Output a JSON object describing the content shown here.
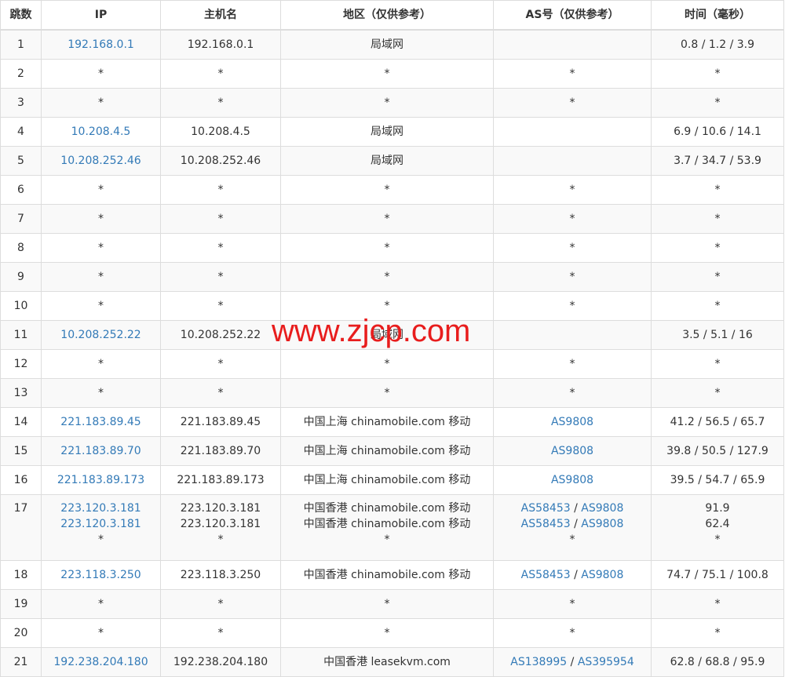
{
  "headers": [
    "跳数",
    "IP",
    "主机名",
    "地区（仅供参考）",
    "AS号（仅供参考）",
    "时间（毫秒）"
  ],
  "rows": [
    {
      "hop": "1",
      "ip": [
        "192.168.0.1"
      ],
      "host": [
        "192.168.0.1"
      ],
      "region": [
        "局域网"
      ],
      "as": [
        []
      ],
      "time": [
        "0.8 / 1.2 / 3.9"
      ]
    },
    {
      "hop": "2",
      "ip": [
        "*"
      ],
      "host": [
        "*"
      ],
      "region": [
        "*"
      ],
      "as": [
        [
          "*"
        ]
      ],
      "time": [
        "*"
      ]
    },
    {
      "hop": "3",
      "ip": [
        "*"
      ],
      "host": [
        "*"
      ],
      "region": [
        "*"
      ],
      "as": [
        [
          "*"
        ]
      ],
      "time": [
        "*"
      ]
    },
    {
      "hop": "4",
      "ip": [
        "10.208.4.5"
      ],
      "host": [
        "10.208.4.5"
      ],
      "region": [
        "局域网"
      ],
      "as": [
        []
      ],
      "time": [
        "6.9 / 10.6 / 14.1"
      ]
    },
    {
      "hop": "5",
      "ip": [
        "10.208.252.46"
      ],
      "host": [
        "10.208.252.46"
      ],
      "region": [
        "局域网"
      ],
      "as": [
        []
      ],
      "time": [
        "3.7 / 34.7 / 53.9"
      ]
    },
    {
      "hop": "6",
      "ip": [
        "*"
      ],
      "host": [
        "*"
      ],
      "region": [
        "*"
      ],
      "as": [
        [
          "*"
        ]
      ],
      "time": [
        "*"
      ]
    },
    {
      "hop": "7",
      "ip": [
        "*"
      ],
      "host": [
        "*"
      ],
      "region": [
        "*"
      ],
      "as": [
        [
          "*"
        ]
      ],
      "time": [
        "*"
      ]
    },
    {
      "hop": "8",
      "ip": [
        "*"
      ],
      "host": [
        "*"
      ],
      "region": [
        "*"
      ],
      "as": [
        [
          "*"
        ]
      ],
      "time": [
        "*"
      ]
    },
    {
      "hop": "9",
      "ip": [
        "*"
      ],
      "host": [
        "*"
      ],
      "region": [
        "*"
      ],
      "as": [
        [
          "*"
        ]
      ],
      "time": [
        "*"
      ]
    },
    {
      "hop": "10",
      "ip": [
        "*"
      ],
      "host": [
        "*"
      ],
      "region": [
        "*"
      ],
      "as": [
        [
          "*"
        ]
      ],
      "time": [
        "*"
      ]
    },
    {
      "hop": "11",
      "ip": [
        "10.208.252.22"
      ],
      "host": [
        "10.208.252.22"
      ],
      "region": [
        "局域网"
      ],
      "as": [
        []
      ],
      "time": [
        "3.5 / 5.1 / 16"
      ]
    },
    {
      "hop": "12",
      "ip": [
        "*"
      ],
      "host": [
        "*"
      ],
      "region": [
        "*"
      ],
      "as": [
        [
          "*"
        ]
      ],
      "time": [
        "*"
      ]
    },
    {
      "hop": "13",
      "ip": [
        "*"
      ],
      "host": [
        "*"
      ],
      "region": [
        "*"
      ],
      "as": [
        [
          "*"
        ]
      ],
      "time": [
        "*"
      ]
    },
    {
      "hop": "14",
      "ip": [
        "221.183.89.45"
      ],
      "host": [
        "221.183.89.45"
      ],
      "region": [
        "中国上海 chinamobile.com 移动"
      ],
      "as": [
        [
          "AS9808"
        ]
      ],
      "time": [
        "41.2 / 56.5 / 65.7"
      ]
    },
    {
      "hop": "15",
      "ip": [
        "221.183.89.70"
      ],
      "host": [
        "221.183.89.70"
      ],
      "region": [
        "中国上海 chinamobile.com 移动"
      ],
      "as": [
        [
          "AS9808"
        ]
      ],
      "time": [
        "39.8 / 50.5 / 127.9"
      ]
    },
    {
      "hop": "16",
      "ip": [
        "221.183.89.173"
      ],
      "host": [
        "221.183.89.173"
      ],
      "region": [
        "中国上海 chinamobile.com 移动"
      ],
      "as": [
        [
          "AS9808"
        ]
      ],
      "time": [
        "39.5 / 54.7 / 65.9"
      ]
    },
    {
      "hop": "17",
      "ip": [
        "223.120.3.181",
        "223.120.3.181",
        "*"
      ],
      "host": [
        "223.120.3.181",
        "223.120.3.181",
        "*"
      ],
      "region": [
        "中国香港 chinamobile.com 移动",
        "中国香港 chinamobile.com 移动",
        "*"
      ],
      "as": [
        [
          "AS58453",
          "AS9808"
        ],
        [
          "AS58453",
          "AS9808"
        ],
        [
          "*"
        ]
      ],
      "time": [
        "91.9",
        "62.4",
        "*"
      ]
    },
    {
      "hop": "18",
      "ip": [
        "223.118.3.250"
      ],
      "host": [
        "223.118.3.250"
      ],
      "region": [
        "中国香港 chinamobile.com 移动"
      ],
      "as": [
        [
          "AS58453",
          "AS9808"
        ]
      ],
      "time": [
        "74.7 / 75.1 / 100.8"
      ]
    },
    {
      "hop": "19",
      "ip": [
        "*"
      ],
      "host": [
        "*"
      ],
      "region": [
        "*"
      ],
      "as": [
        [
          "*"
        ]
      ],
      "time": [
        "*"
      ]
    },
    {
      "hop": "20",
      "ip": [
        "*"
      ],
      "host": [
        "*"
      ],
      "region": [
        "*"
      ],
      "as": [
        [
          "*"
        ]
      ],
      "time": [
        "*"
      ]
    },
    {
      "hop": "21",
      "ip": [
        "192.238.204.180"
      ],
      "host": [
        "192.238.204.180"
      ],
      "region": [
        "中国香港 leasekvm.com"
      ],
      "as": [
        [
          "AS138995",
          "AS395954"
        ]
      ],
      "time": [
        "62.8 / 68.8 / 95.9"
      ]
    }
  ],
  "watermark": "www.zjcp.com",
  "colors": {
    "link": "#337ab7",
    "watermark": "#e81d1d",
    "stripe": "#f9f9f9",
    "border": "#dddddd"
  }
}
